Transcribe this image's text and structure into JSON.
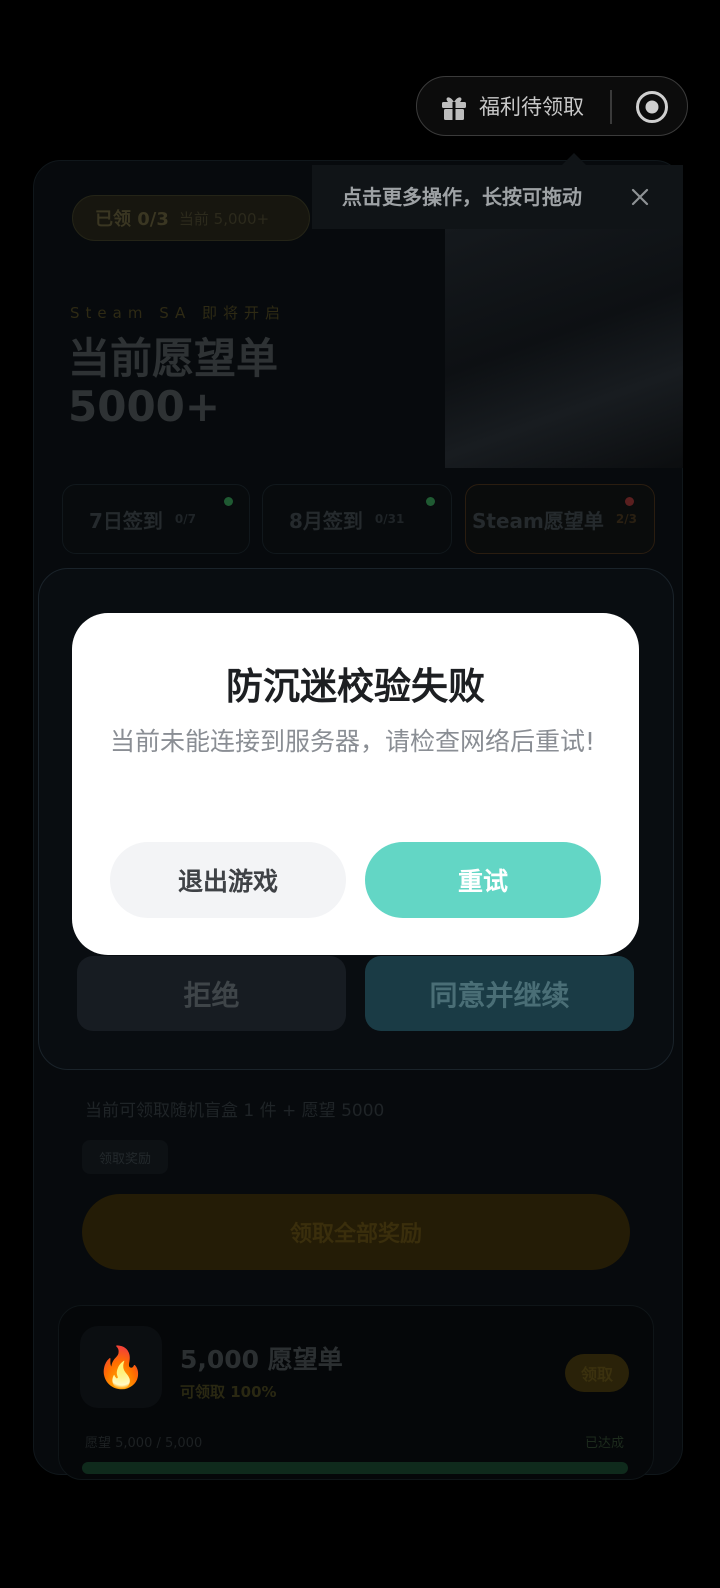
{
  "background": {
    "badge": {
      "text": "已领 0/3",
      "sub": "当前 5,000+"
    },
    "kicker": "Steam SA 即将开启",
    "headline": [
      "当前愿望单",
      "5000+"
    ],
    "tabs": [
      {
        "label": "7日签到",
        "count": "0/7",
        "dot_color": "#1f5a32"
      },
      {
        "label": "8月签到",
        "count": "0/31",
        "dot_color": "#1f5a32"
      },
      {
        "label": "Steam愿望单",
        "count": "2/3",
        "dot_color": "#5a1f1f"
      }
    ],
    "buttons": {
      "reject": "拒绝",
      "agree": "同意并继续"
    },
    "reward_line": "当前可领取随机盲盒 1 件 + 愿望 5000",
    "chip": "领取奖励",
    "claim_all": "领取全部奖励",
    "reward_card": {
      "icon": "fire-icon",
      "title": "5,000 愿望单",
      "subtitle": "可领取 100%",
      "pill": "领取",
      "progress_text": "愿望 5,000 / 5,000",
      "progress_right": "已达成",
      "progress": 1.0
    }
  },
  "capsule": {
    "label": "福利待领取",
    "icons": [
      "gift-icon",
      "record-icon"
    ]
  },
  "tooltip": {
    "text": "点击更多操作，长按可拖动"
  },
  "dialog": {
    "title": "防沉迷校验失败",
    "message": "当前未能连接到服务器，请检查网络后重试!",
    "exit_label": "退出游戏",
    "retry_label": "重试"
  },
  "colors": {
    "accent": "#63d6c5",
    "dialog_bg": "#ffffff",
    "capsule_bg": "#0c0c0c"
  }
}
